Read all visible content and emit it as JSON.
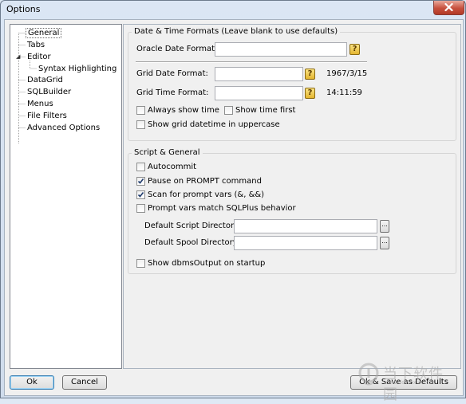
{
  "window": {
    "title": "Options"
  },
  "tree": {
    "items": [
      {
        "label": "General",
        "selected": true
      },
      {
        "label": "Tabs"
      },
      {
        "label": "Editor",
        "expanded": true
      },
      {
        "label": "Syntax Highlighting",
        "child": true
      },
      {
        "label": "DataGrid"
      },
      {
        "label": "SQLBuilder"
      },
      {
        "label": "Menus"
      },
      {
        "label": "File Filters"
      },
      {
        "label": "Advanced Options"
      }
    ],
    "expander_glyph": "◢"
  },
  "datetime": {
    "group_title": "Date & Time Formats (Leave blank to use defaults)",
    "oracle_date_label": "Oracle Date Format:",
    "oracle_date_value": "",
    "grid_date_label": "Grid Date Format:",
    "grid_date_value": "",
    "grid_date_preview": "1967/3/15",
    "grid_time_label": "Grid Time Format:",
    "grid_time_value": "",
    "grid_time_preview": "14:11:59",
    "help_glyph": "?",
    "always_show_time": {
      "label": "Always show time",
      "checked": false
    },
    "show_time_first": {
      "label": "Show time first",
      "checked": false
    },
    "show_uppercase": {
      "label": "Show grid datetime in uppercase",
      "checked": false
    }
  },
  "script": {
    "group_title": "Script & General",
    "autocommit": {
      "label": "Autocommit",
      "checked": false
    },
    "pause_prompt": {
      "label": "Pause on PROMPT command",
      "checked": true
    },
    "scan_prompt": {
      "label": "Scan for prompt vars (&, &&)",
      "checked": true
    },
    "prompt_sqlplus": {
      "label": "Prompt vars match SQLPlus behavior",
      "checked": false
    },
    "default_script_dir_label": "Default Script Directory:",
    "default_script_dir_value": "",
    "default_spool_dir_label": "Default Spool Directory:",
    "default_spool_dir_value": "",
    "browse_label": "...",
    "show_dbms_output": {
      "label": "Show dbmsOutput on startup",
      "checked": false
    }
  },
  "buttons": {
    "ok": "Ok",
    "cancel": "Cancel",
    "ok_save_defaults": "Ok & Save as Defaults"
  },
  "watermark": {
    "text": "当下软件园",
    "sub": "www.downxia.com"
  },
  "colors": {
    "check": "#1f3b6d",
    "close_button": "#c7503d",
    "help_button": "#e4b52f"
  }
}
